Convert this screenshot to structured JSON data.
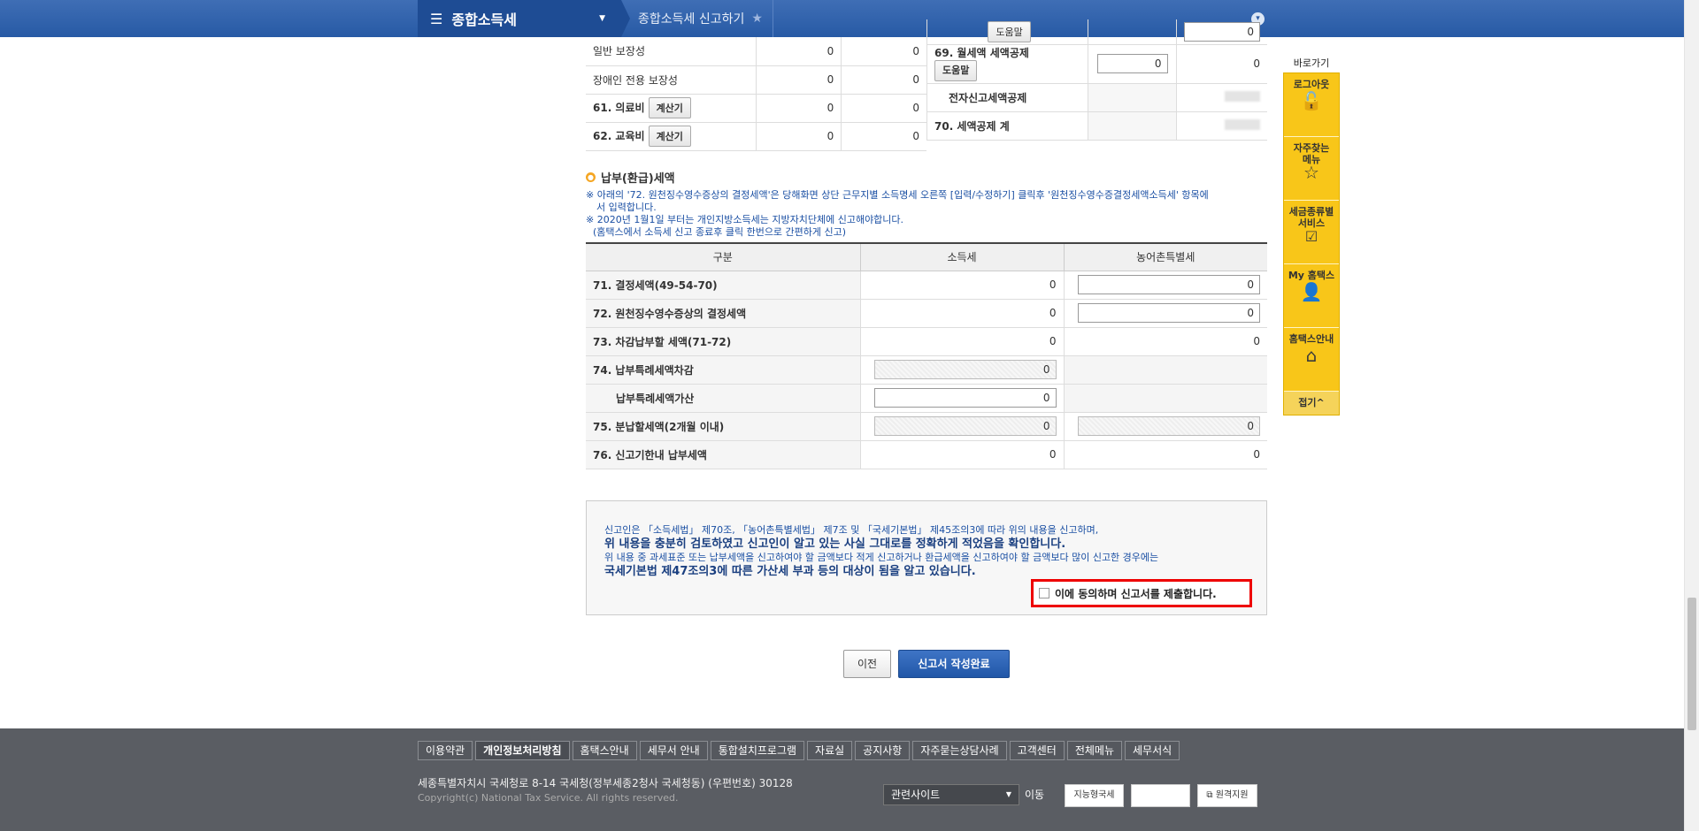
{
  "header": {
    "menu_title": "종합소득세",
    "crumb": "종합소득세 신고하기"
  },
  "deduction_table": {
    "left_rows": [
      {
        "label": "일반 보장성",
        "v1": "0",
        "v2": "0"
      },
      {
        "label": "장애인 전용 보장성",
        "v1": "0",
        "v2": "0"
      },
      {
        "label": "61. 의료비",
        "button": "계산기",
        "v1": "0",
        "v2": "0"
      },
      {
        "label": "62. 교육비",
        "button": "계산기",
        "v1": "0",
        "v2": "0"
      }
    ],
    "right_rows": [
      {
        "label": "",
        "button": "도움말",
        "input": "0"
      },
      {
        "label": "69. 월세액 세액공제",
        "button": "도움말",
        "input": "0",
        "value": "0"
      },
      {
        "label": "전자신고세액공제"
      },
      {
        "label": "70. 세액공제 계"
      }
    ]
  },
  "section": {
    "title": "납부(환급)세액",
    "notes": [
      "※ 아래의 '72. 원천징수영수증상의 결정세액'은 당해화면 상단 근무지별 소득명세 오른쪽 [입력/수정하기] 클릭후 '원천징수영수증결정세액소득세' 항목에",
      "서 입력합니다.",
      "※ 2020년 1월1일 부터는 개인지방소득세는 지방자치단체에 신고해야합니다.",
      "(홈택스에서 소득세 신고 종료후 클릭 한번으로 간편하게 신고)"
    ]
  },
  "pay_table": {
    "headers": [
      "구분",
      "소득세",
      "농어촌특별세"
    ],
    "rows": [
      {
        "label": "71. 결정세액(49-54-70)",
        "income": "0",
        "rural": "0"
      },
      {
        "label": "72. 원천징수영수증상의 결정세액",
        "income": "0",
        "rural": "0"
      },
      {
        "label": "73. 차감납부할 세액(71-72)",
        "income": "0",
        "rural": "0"
      },
      {
        "label": "74. 납부특례세액차감",
        "income": "0",
        "rural": ""
      },
      {
        "label": "납부특례세액가산",
        "income": "0",
        "rural": ""
      },
      {
        "label": "75. 분납할세액(2개월 이내)",
        "income": "0",
        "rural": "0"
      },
      {
        "label": "76. 신고기한내 납부세액",
        "income": "0",
        "rural": "0"
      }
    ]
  },
  "declaration": {
    "line1": "신고인은 「소득세법」 제70조, 「농어촌특별세법」 제7조 및 「국세기본법」 제45조의3에 따라 위의 내용을 신고하며,",
    "line2": "위 내용을 충분히 검토하였고 신고인이 알고 있는 사실 그대로를 정확하게 적었음을 확인합니다.",
    "line3": "위 내용 중 과세표준 또는 납부세액을 신고하여야 할 금액보다 적게 신고하거나 환급세액을 신고하여야 할 금액보다 많이 신고한 경우에는",
    "line4": "국세기본법 제47조의3에 따른 가산세 부과 등의 대상이 됨을 알고 있습니다.",
    "agree": "이에 동의하며 신고서를 제출합니다."
  },
  "buttons": {
    "prev": "이전",
    "done": "신고서 작성완료"
  },
  "quick_menu": {
    "title": "바로가기",
    "items": [
      {
        "label": "로그아웃",
        "icon": "unlock-icon"
      },
      {
        "label": "자주찾는 메뉴",
        "icon": "star-icon"
      },
      {
        "label": "세금종류별 서비스",
        "icon": "check-icon"
      },
      {
        "label": "My 홈택스",
        "icon": "user-icon"
      },
      {
        "label": "홈택스안내",
        "icon": "house-icon"
      }
    ],
    "fold": "접기^"
  },
  "footer": {
    "links": [
      "이용약관",
      "개인정보처리방침",
      "홈택스안내",
      "세무서 안내",
      "통합설치프로그램",
      "자료실",
      "공지사항",
      "자주묻는상담사례",
      "고객센터",
      "전체메뉴",
      "세무서식"
    ],
    "address": "세종특별자치시 국세청로 8-14 국세청(정부세종2청사 국세청동) (우편번호) 30128",
    "copyright": "Copyright(c) National Tax Service. All rights reserved.",
    "related_select": "관련사이트",
    "go": "이동",
    "badge1": "지능형국세",
    "badge2": "",
    "badge3": "원격지원"
  }
}
